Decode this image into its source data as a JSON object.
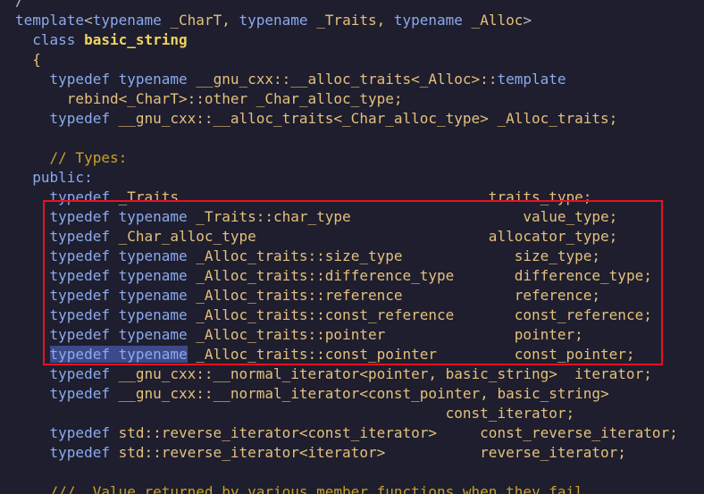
{
  "editor": {
    "lines": [
      {
        "indent": "",
        "parts": [
          {
            "t": "/",
            "c": "pun"
          }
        ]
      },
      {
        "indent": "",
        "parts": [
          {
            "t": "template",
            "c": "kw"
          },
          {
            "t": "<",
            "c": "pun"
          },
          {
            "t": "typename",
            "c": "kw"
          },
          {
            "t": " _CharT, ",
            "c": "yel"
          },
          {
            "t": "typename",
            "c": "kw"
          },
          {
            "t": " _Traits, ",
            "c": "yel"
          },
          {
            "t": "typename",
            "c": "kw"
          },
          {
            "t": " _Alloc",
            "c": "yel"
          },
          {
            "t": ">",
            "c": "pun"
          }
        ]
      },
      {
        "indent": "  ",
        "parts": [
          {
            "t": "class ",
            "c": "kw"
          },
          {
            "t": "basic_string",
            "c": "cls"
          }
        ]
      },
      {
        "indent": "  ",
        "parts": [
          {
            "t": "{",
            "c": "yel"
          }
        ]
      },
      {
        "indent": "    ",
        "parts": [
          {
            "t": "typedef ",
            "c": "kw"
          },
          {
            "t": "typename ",
            "c": "kw"
          },
          {
            "t": "__gnu_cxx::__alloc_traits<_Alloc>::",
            "c": "yel"
          },
          {
            "t": "template",
            "c": "kw"
          }
        ]
      },
      {
        "indent": "      ",
        "parts": [
          {
            "t": "rebind<_CharT>::other _Char_alloc_type;",
            "c": "yel"
          }
        ]
      },
      {
        "indent": "    ",
        "parts": [
          {
            "t": "typedef ",
            "c": "kw"
          },
          {
            "t": "__gnu_cxx::__alloc_traits<_Char_alloc_type> _Alloc_traits;",
            "c": "yel"
          }
        ]
      },
      {
        "indent": "",
        "parts": []
      },
      {
        "indent": "    ",
        "parts": [
          {
            "t": "// Types:",
            "c": "cmt"
          }
        ]
      },
      {
        "indent": "  ",
        "parts": [
          {
            "t": "public:",
            "c": "kw"
          }
        ]
      },
      {
        "indent": "    ",
        "parts": [
          {
            "t": "typedef ",
            "c": "kw"
          },
          {
            "t": "_Traits                                    traits_type;",
            "c": "yel"
          }
        ]
      },
      {
        "indent": "    ",
        "parts": [
          {
            "t": "typedef ",
            "c": "kw"
          },
          {
            "t": "typename ",
            "c": "kw"
          },
          {
            "t": "_Traits::char_type                    value_type;",
            "c": "yel"
          }
        ]
      },
      {
        "indent": "    ",
        "parts": [
          {
            "t": "typedef ",
            "c": "kw"
          },
          {
            "t": "_Char_alloc_type                           allocator_type;",
            "c": "yel"
          }
        ]
      },
      {
        "indent": "    ",
        "parts": [
          {
            "t": "typedef ",
            "c": "kw"
          },
          {
            "t": "typename ",
            "c": "kw"
          },
          {
            "t": "_Alloc_traits::size_type             size_type;",
            "c": "yel"
          }
        ]
      },
      {
        "indent": "    ",
        "parts": [
          {
            "t": "typedef ",
            "c": "kw"
          },
          {
            "t": "typename ",
            "c": "kw"
          },
          {
            "t": "_Alloc_traits::difference_type       difference_type;",
            "c": "yel"
          }
        ]
      },
      {
        "indent": "    ",
        "parts": [
          {
            "t": "typedef ",
            "c": "kw"
          },
          {
            "t": "typename ",
            "c": "kw"
          },
          {
            "t": "_Alloc_traits::reference             reference;",
            "c": "yel"
          }
        ]
      },
      {
        "indent": "    ",
        "parts": [
          {
            "t": "typedef ",
            "c": "kw"
          },
          {
            "t": "typename ",
            "c": "kw"
          },
          {
            "t": "_Alloc_traits::const_reference       const_reference;",
            "c": "yel"
          }
        ]
      },
      {
        "indent": "    ",
        "parts": [
          {
            "t": "typedef ",
            "c": "kw"
          },
          {
            "t": "typename ",
            "c": "kw"
          },
          {
            "t": "_Alloc_traits::pointer               pointer;",
            "c": "yel"
          }
        ]
      },
      {
        "indent": "    ",
        "parts": [
          {
            "t": "typedef typename",
            "c": "kw sel"
          },
          {
            "t": " _Alloc_traits::const_pointer         const_pointer;",
            "c": "yel"
          }
        ]
      },
      {
        "indent": "    ",
        "parts": [
          {
            "t": "typedef ",
            "c": "kw"
          },
          {
            "t": "__gnu_cxx::__normal_iterator<pointer, basic_string>  iterator;",
            "c": "yel"
          }
        ]
      },
      {
        "indent": "    ",
        "parts": [
          {
            "t": "typedef ",
            "c": "kw"
          },
          {
            "t": "__gnu_cxx::__normal_iterator<const_pointer, basic_string>",
            "c": "yel"
          }
        ]
      },
      {
        "indent": "                                                  ",
        "parts": [
          {
            "t": "const_iterator;",
            "c": "yel"
          }
        ]
      },
      {
        "indent": "    ",
        "parts": [
          {
            "t": "typedef ",
            "c": "kw"
          },
          {
            "t": "std::reverse_iterator<const_iterator>     const_reverse_iterator;",
            "c": "yel"
          }
        ]
      },
      {
        "indent": "    ",
        "parts": [
          {
            "t": "typedef ",
            "c": "kw"
          },
          {
            "t": "std::reverse_iterator<iterator>           reverse_iterator;",
            "c": "yel"
          }
        ]
      },
      {
        "indent": "",
        "parts": []
      },
      {
        "indent": "    ",
        "parts": [
          {
            "t": "///  Value returned by various member functions when they fail.",
            "c": "cmt"
          }
        ]
      }
    ]
  }
}
